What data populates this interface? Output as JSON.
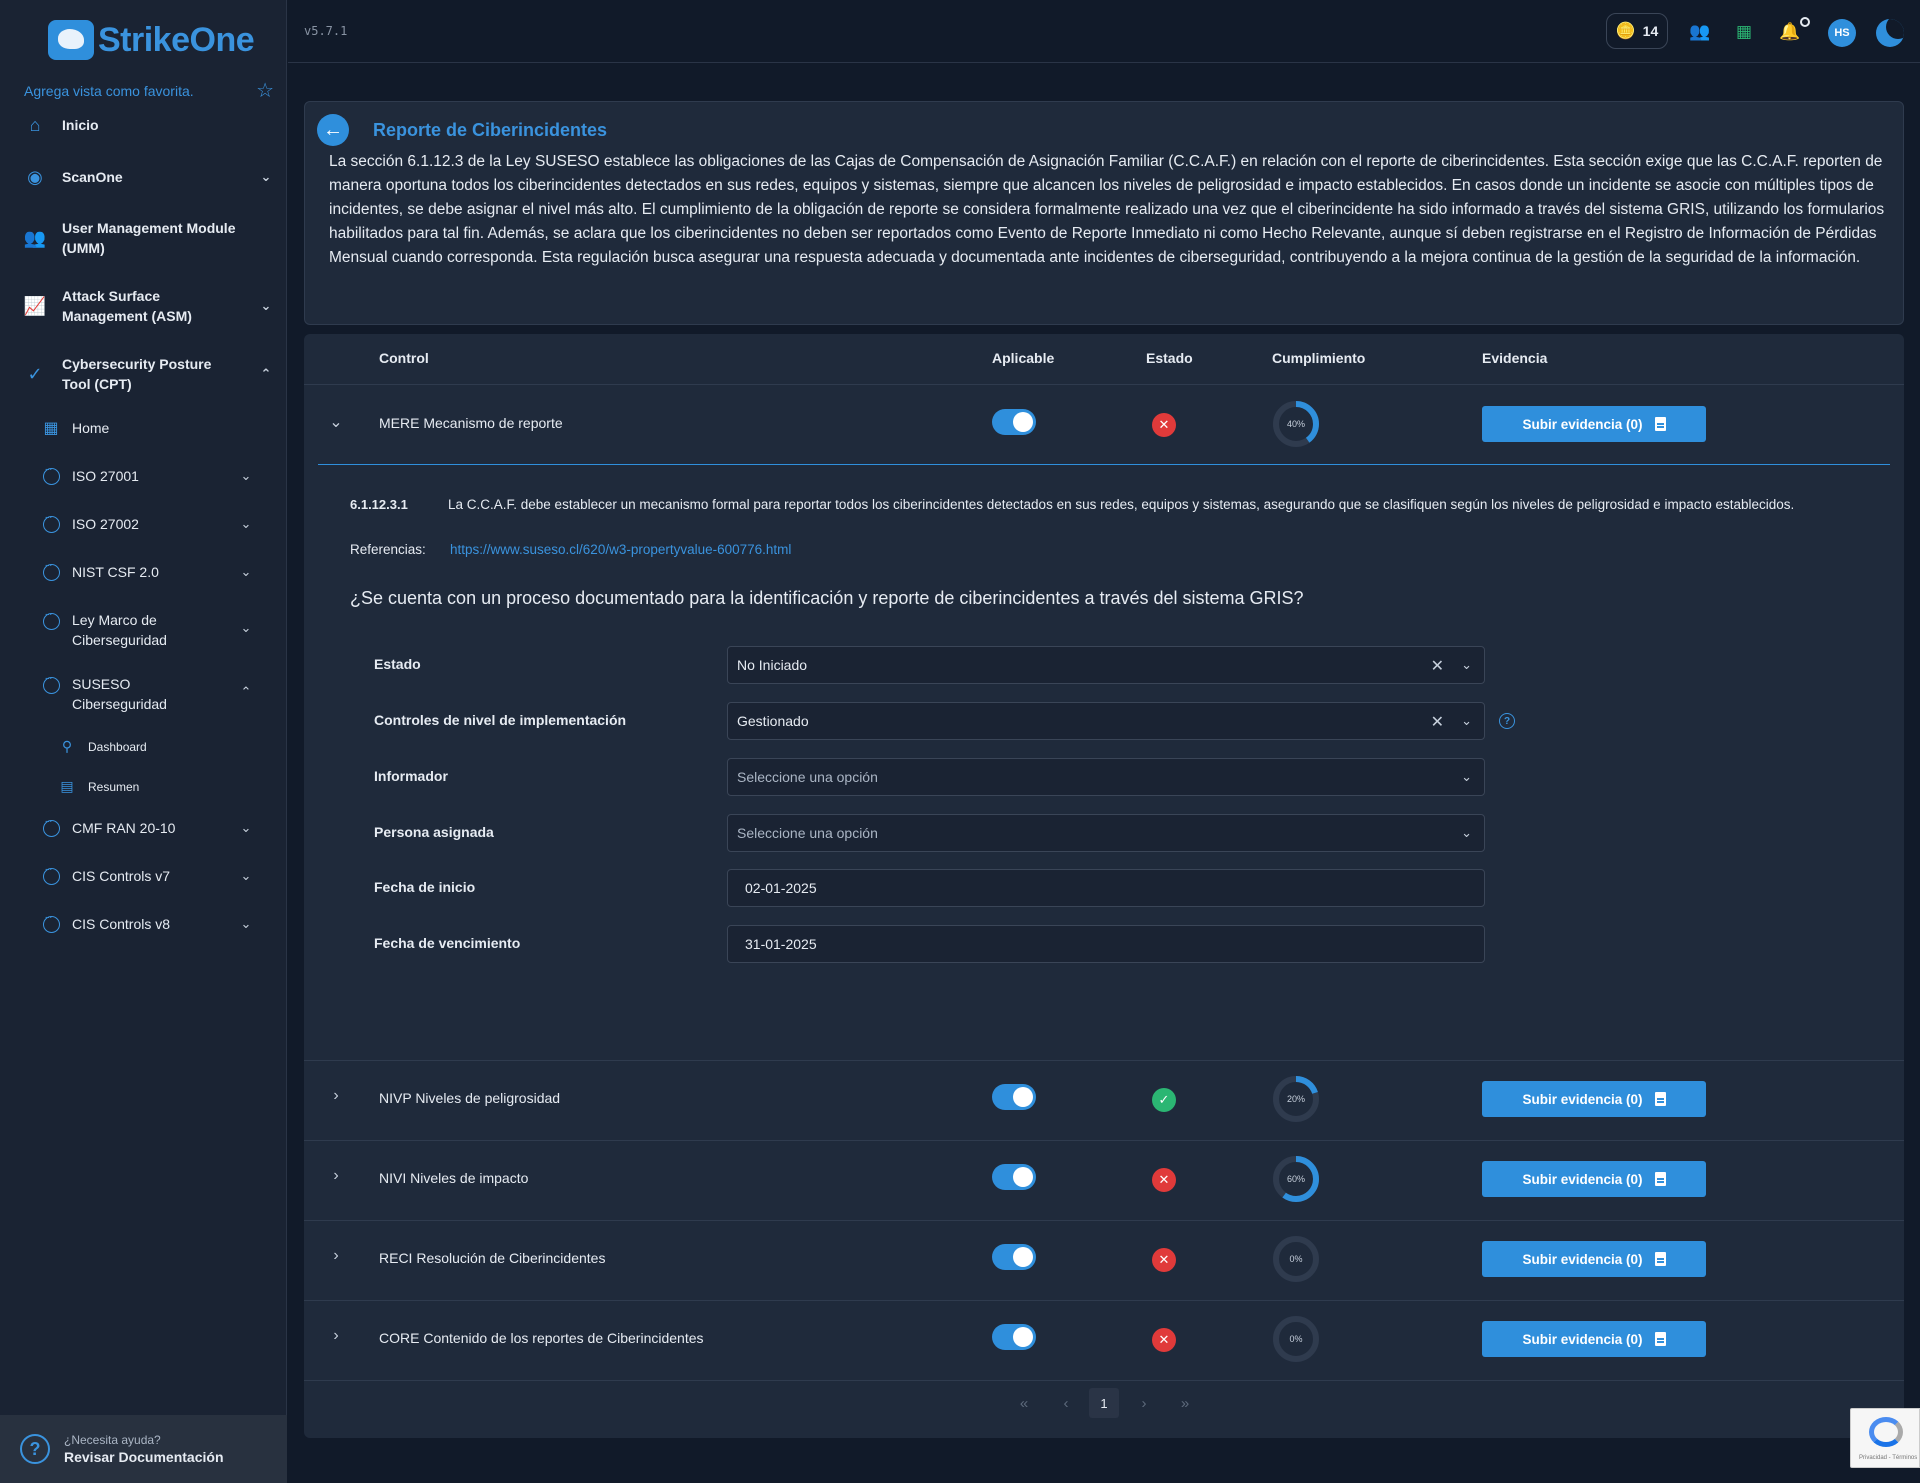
{
  "app": {
    "logo_text": "StrikeOne",
    "version": "v5.7.1"
  },
  "sidebar": {
    "favorite_text": "Agrega vista como favorita.",
    "items": [
      {
        "label": "Inicio",
        "icon": "home-icon"
      },
      {
        "label": "ScanOne",
        "icon": "eye-icon"
      },
      {
        "label": "User Management Module (UMM)",
        "icon": "users-icon"
      },
      {
        "label": "Attack Surface Management (ASM)",
        "icon": "chart-icon"
      },
      {
        "label": "Cybersecurity Posture Tool (CPT)",
        "icon": "check-circle-icon"
      }
    ],
    "cpt_items": [
      {
        "label": "Home"
      },
      {
        "label": "ISO 27001"
      },
      {
        "label": "ISO 27002"
      },
      {
        "label": "NIST CSF 2.0"
      },
      {
        "label": "Ley Marco de Ciberseguridad"
      },
      {
        "label": "SUSESO Ciberseguridad"
      },
      {
        "label": "CMF RAN 20-10"
      },
      {
        "label": "CIS Controls v7"
      },
      {
        "label": "CIS Controls v8"
      }
    ],
    "suseso_items": [
      {
        "label": "Dashboard"
      },
      {
        "label": "Resumen"
      }
    ],
    "help": {
      "question": "¿Necesita ayuda?",
      "link": "Revisar Documentación"
    }
  },
  "topbar": {
    "credits": "14",
    "avatar_initials": "HS"
  },
  "intro": {
    "title": "Reporte de Ciberincidentes",
    "text": "La sección 6.1.12.3 de la Ley SUSESO establece las obligaciones de las Cajas de Compensación de Asignación Familiar (C.C.A.F.) en relación con el reporte de ciberincidentes. Esta sección exige que las C.C.A.F. reporten de manera oportuna todos los ciberincidentes detectados en sus redes, equipos y sistemas, siempre que alcancen los niveles de peligrosidad e impacto establecidos. En casos donde un incidente se asocie con múltiples tipos de incidentes, se debe asignar el nivel más alto. El cumplimiento de la obligación de reporte se considera formalmente realizado una vez que el ciberincidente ha sido informado a través del sistema GRIS, utilizando los formularios habilitados para tal fin. Además, se aclara que los ciberincidentes no deben ser reportados como Evento de Reporte Inmediato ni como Hecho Relevante, aunque sí deben registrarse en el Registro de Información de Pérdidas Mensual cuando corresponda. Esta regulación busca asegurar una respuesta adecuada y documentada ante incidentes de ciberseguridad, contribuyendo a la mejora continua de la gestión de la seguridad de la información."
  },
  "table": {
    "headers": {
      "control": "Control",
      "aplicable": "Aplicable",
      "estado": "Estado",
      "cumplimiento": "Cumplimiento",
      "evidencia": "Evidencia"
    },
    "rows": [
      {
        "control": "MERE Mecanismo de reporte",
        "aplicable": true,
        "estado": "error",
        "cumplimiento": 40,
        "cumplimiento_label": "40%",
        "evidencia": "Subir evidencia (0)"
      },
      {
        "control": "NIVP Niveles de peligrosidad",
        "aplicable": true,
        "estado": "ok",
        "cumplimiento": 20,
        "cumplimiento_label": "20%",
        "evidencia": "Subir evidencia (0)"
      },
      {
        "control": "NIVI Niveles de impacto",
        "aplicable": true,
        "estado": "error",
        "cumplimiento": 60,
        "cumplimiento_label": "60%",
        "evidencia": "Subir evidencia (0)"
      },
      {
        "control": "RECI Resolución de Ciberincidentes",
        "aplicable": true,
        "estado": "error",
        "cumplimiento": 0,
        "cumplimiento_label": "0%",
        "evidencia": "Subir evidencia (0)"
      },
      {
        "control": "CORE Contenido de los reportes de Ciberincidentes",
        "aplicable": true,
        "estado": "error",
        "cumplimiento": 0,
        "cumplimiento_label": "0%",
        "evidencia": "Subir evidencia (0)"
      }
    ]
  },
  "detail": {
    "code": "6.1.12.3.1",
    "requirement": "La C.C.A.F. debe establecer un mecanismo formal para reportar todos los ciberincidentes detectados en sus redes, equipos y sistemas, asegurando que se clasifiquen según los niveles de peligrosidad e impacto establecidos.",
    "ref_label": "Referencias:",
    "ref_link": "https://www.suseso.cl/620/w3-propertyvalue-600776.html",
    "question": "¿Se cuenta con un proceso documentado para la identificación y reporte de ciberincidentes a través del sistema GRIS?",
    "fields": {
      "estado": {
        "label": "Estado",
        "value": "No Iniciado"
      },
      "nivel": {
        "label": "Controles de nivel de implementación",
        "value": "Gestionado"
      },
      "informador": {
        "label": "Informador",
        "placeholder": "Seleccione una opción"
      },
      "persona": {
        "label": "Persona asignada",
        "placeholder": "Seleccione una opción"
      },
      "inicio": {
        "label": "Fecha de inicio",
        "value": "02-01-2025"
      },
      "vencimiento": {
        "label": "Fecha de vencimiento",
        "value": "31-01-2025"
      }
    }
  },
  "pagination": {
    "first": "«",
    "prev": "‹",
    "current": "1",
    "next": "›",
    "last": "»"
  },
  "recaptcha": {
    "text": "Privacidad - Términos"
  },
  "colors": {
    "accent": "#2f8fdc",
    "error": "#e03a3a",
    "success": "#2bb673",
    "background": "#111a29",
    "panel": "#1f2a3b"
  }
}
